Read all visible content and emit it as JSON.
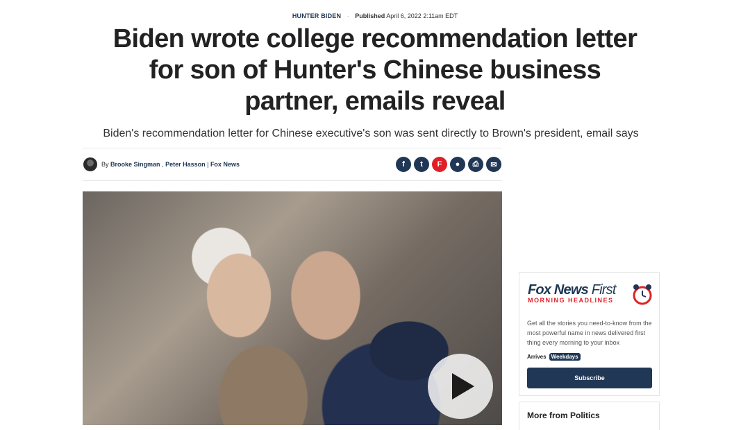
{
  "article": {
    "category": "HUNTER BIDEN",
    "published_label": "Published",
    "published_date": "April 6, 2022 2:11am EDT",
    "headline": "Biden wrote college recommendation letter for son of Hunter's Chinese business partner, emails reveal",
    "subhead": "Biden's recommendation letter for Chinese executive's son was sent directly to Brown's president, email says",
    "byline_prefix": "By",
    "authors": [
      "Brooke Singman",
      "Peter Hasson"
    ],
    "outlet": "Fox News"
  },
  "share": [
    "f",
    "t",
    "F",
    "●",
    "⎙",
    "✉"
  ],
  "promo": {
    "title_bold": "Fox News",
    "title_light": "First",
    "subtitle": "MORNING HEADLINES",
    "description": "Get all the stories you need-to-know from the most powerful name in news delivered first thing every morning to your inbox",
    "arrives_label": "Arrives",
    "arrives_badge": "Weekdays",
    "button": "Subscribe"
  },
  "more": {
    "title": "More from Politics"
  },
  "colors": {
    "brand_navy": "#203755",
    "brand_red": "#e02027"
  }
}
